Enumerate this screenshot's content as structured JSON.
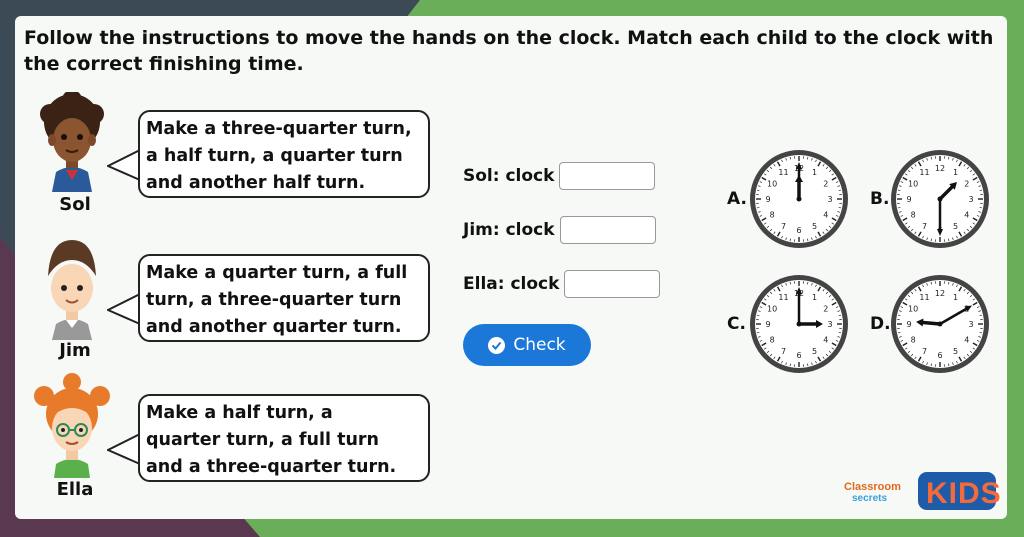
{
  "title": "Follow the instructions to move the hands on the clock. Match each child to the clock with the correct finishing time.",
  "children": [
    {
      "name": "Sol",
      "instruction_lines": [
        "Make a three-quarter turn,",
        "a half turn, a quarter turn",
        "and another half turn."
      ]
    },
    {
      "name": "Jim",
      "instruction_lines": [
        "Make a quarter turn, a full",
        "turn, a three-quarter turn",
        "and another quarter turn."
      ]
    },
    {
      "name": "Ella",
      "instruction_lines": [
        "Make a half turn, a",
        "quarter turn, a full turn",
        "and a three-quarter turn."
      ]
    }
  ],
  "answers": [
    {
      "label": "Sol: clock",
      "value": ""
    },
    {
      "label": "Jim: clock",
      "value": ""
    },
    {
      "label": "Ella: clock",
      "value": ""
    }
  ],
  "check_button": {
    "label": "Check"
  },
  "clocks": [
    {
      "letter": "A.",
      "time": "12:00"
    },
    {
      "letter": "B.",
      "time": "1:30"
    },
    {
      "letter": "C.",
      "time": "3:00"
    },
    {
      "letter": "D.",
      "time": "9:10"
    }
  ],
  "logo": {
    "line1": "Classroom",
    "line2": "secrets",
    "kids": "KIDS"
  },
  "colors": {
    "accent": "#1c78d8",
    "background_green": "#6aae5a",
    "panel": "#f7f9f7"
  }
}
